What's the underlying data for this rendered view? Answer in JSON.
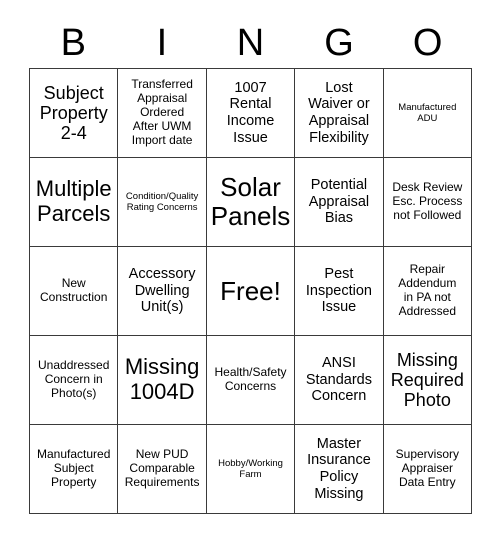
{
  "header": {
    "letters": [
      "B",
      "I",
      "N",
      "G",
      "O"
    ]
  },
  "grid": {
    "rows": [
      [
        {
          "text": "Subject\nProperty\n2-4",
          "size": "sz-l"
        },
        {
          "text": "Transferred\nAppraisal\nOrdered\nAfter UWM\nImport date",
          "size": "sz-s"
        },
        {
          "text": "1007\nRental\nIncome\nIssue",
          "size": "sz-m"
        },
        {
          "text": "Lost\nWaiver or\nAppraisal\nFlexibility",
          "size": "sz-m"
        },
        {
          "text": "Manufactured\nADU",
          "size": "sz-xs"
        }
      ],
      [
        {
          "text": "Multiple\nParcels",
          "size": "sz-xl"
        },
        {
          "text": "Condition/Quality\nRating Concerns",
          "size": "sz-xs"
        },
        {
          "text": "Solar\nPanels",
          "size": "sz-xxl"
        },
        {
          "text": "Potential\nAppraisal\nBias",
          "size": "sz-m"
        },
        {
          "text": "Desk Review\nEsc. Process\nnot Followed",
          "size": "sz-s"
        }
      ],
      [
        {
          "text": "New\nConstruction",
          "size": "sz-s"
        },
        {
          "text": "Accessory\nDwelling\nUnit(s)",
          "size": "sz-m"
        },
        {
          "text": "Free!",
          "size": "sz-xxl"
        },
        {
          "text": "Pest\nInspection\nIssue",
          "size": "sz-m"
        },
        {
          "text": "Repair\nAddendum\nin PA not\nAddressed",
          "size": "sz-s"
        }
      ],
      [
        {
          "text": "Unaddressed\nConcern in\nPhoto(s)",
          "size": "sz-s"
        },
        {
          "text": "Missing\n1004D",
          "size": "sz-xl"
        },
        {
          "text": "Health/Safety\nConcerns",
          "size": "sz-s"
        },
        {
          "text": "ANSI\nStandards\nConcern",
          "size": "sz-m"
        },
        {
          "text": "Missing\nRequired\nPhoto",
          "size": "sz-l"
        }
      ],
      [
        {
          "text": "Manufactured\nSubject\nProperty",
          "size": "sz-s"
        },
        {
          "text": "New PUD\nComparable\nRequirements",
          "size": "sz-s"
        },
        {
          "text": "Hobby/Working\nFarm",
          "size": "sz-xs"
        },
        {
          "text": "Master\nInsurance\nPolicy\nMissing",
          "size": "sz-m"
        },
        {
          "text": "Supervisory\nAppraiser\nData Entry",
          "size": "sz-s"
        }
      ]
    ]
  },
  "colors": {
    "background": "#ffffff",
    "text": "#000000",
    "border": "#3a3a3a"
  }
}
